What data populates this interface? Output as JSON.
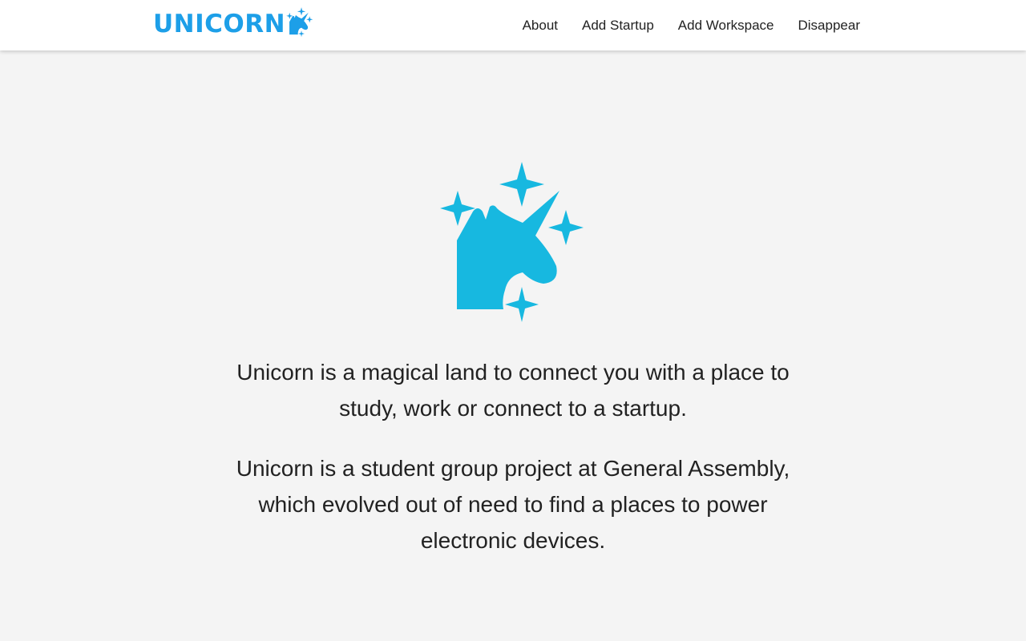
{
  "brand": {
    "name": "UNICORN",
    "logo_icon": "unicorn-sparkles-icon",
    "color": "#1d9fe8"
  },
  "nav": {
    "items": [
      {
        "label": "About"
      },
      {
        "label": "Add Startup"
      },
      {
        "label": "Add Workspace"
      },
      {
        "label": "Disappear"
      }
    ]
  },
  "hero": {
    "icon": "unicorn-sparkles-icon",
    "icon_color": "#17b8e0"
  },
  "about": {
    "paragraph1": "Unicorn is a magical land to connect you with a place to study, work or connect to a startup.",
    "paragraph2": "Unicorn is a student group project at General Assembly, which evolved out of need to find a places to power electronic devices."
  },
  "colors": {
    "background": "#f4f4f4",
    "navbar": "#ffffff",
    "text": "#222222"
  }
}
